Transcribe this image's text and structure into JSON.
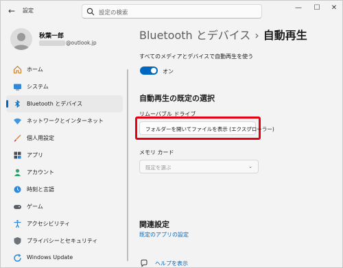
{
  "titlebar": {
    "app_title": "設定",
    "search_placeholder": "設定の検索",
    "back_icon": "back-arrow-icon",
    "minimize_icon": "minimize-icon",
    "maximize_icon": "maximize-icon",
    "close_icon": "close-icon"
  },
  "profile": {
    "name": "秋葉一郎",
    "email_suffix": "@outlook.jp"
  },
  "sidebar": {
    "items": [
      {
        "label": "ホーム",
        "icon": "home-icon",
        "active": false
      },
      {
        "label": "システム",
        "icon": "system-icon",
        "active": false
      },
      {
        "label": "Bluetooth とデバイス",
        "icon": "bluetooth-icon",
        "active": true
      },
      {
        "label": "ネットワークとインターネット",
        "icon": "network-icon",
        "active": false
      },
      {
        "label": "個人用設定",
        "icon": "personalization-icon",
        "active": false
      },
      {
        "label": "アプリ",
        "icon": "apps-icon",
        "active": false
      },
      {
        "label": "アカウント",
        "icon": "account-icon",
        "active": false
      },
      {
        "label": "時刻と言語",
        "icon": "time-language-icon",
        "active": false
      },
      {
        "label": "ゲーム",
        "icon": "gaming-icon",
        "active": false
      },
      {
        "label": "アクセシビリティ",
        "icon": "accessibility-icon",
        "active": false
      },
      {
        "label": "プライバシーとセキュリティ",
        "icon": "privacy-icon",
        "active": false
      },
      {
        "label": "Windows Update",
        "icon": "windows-update-icon",
        "active": false
      }
    ]
  },
  "main": {
    "breadcrumb_parent": "Bluetooth とデバイス",
    "breadcrumb_sep": "›",
    "breadcrumb_current": "自動再生",
    "use_autoplay_label": "すべてのメディアとデバイスで自動再生を使う",
    "toggle_state": "オン",
    "section_title": "自動再生の既定の選択",
    "removable_label": "リムーバブル ドライブ",
    "removable_value": "フォルダーを開いてファイルを表示 (エクスプローラー)",
    "memory_card_label": "メモリ カード",
    "memory_card_value": "既定を選ぶ",
    "chevron": "⌄",
    "related_title": "関連設定",
    "related_link": "既定のアプリの設定",
    "help_link": "ヘルプを表示"
  },
  "colors": {
    "accent": "#0067c0",
    "highlight": "#e60012",
    "background": "#f3f3f3"
  }
}
